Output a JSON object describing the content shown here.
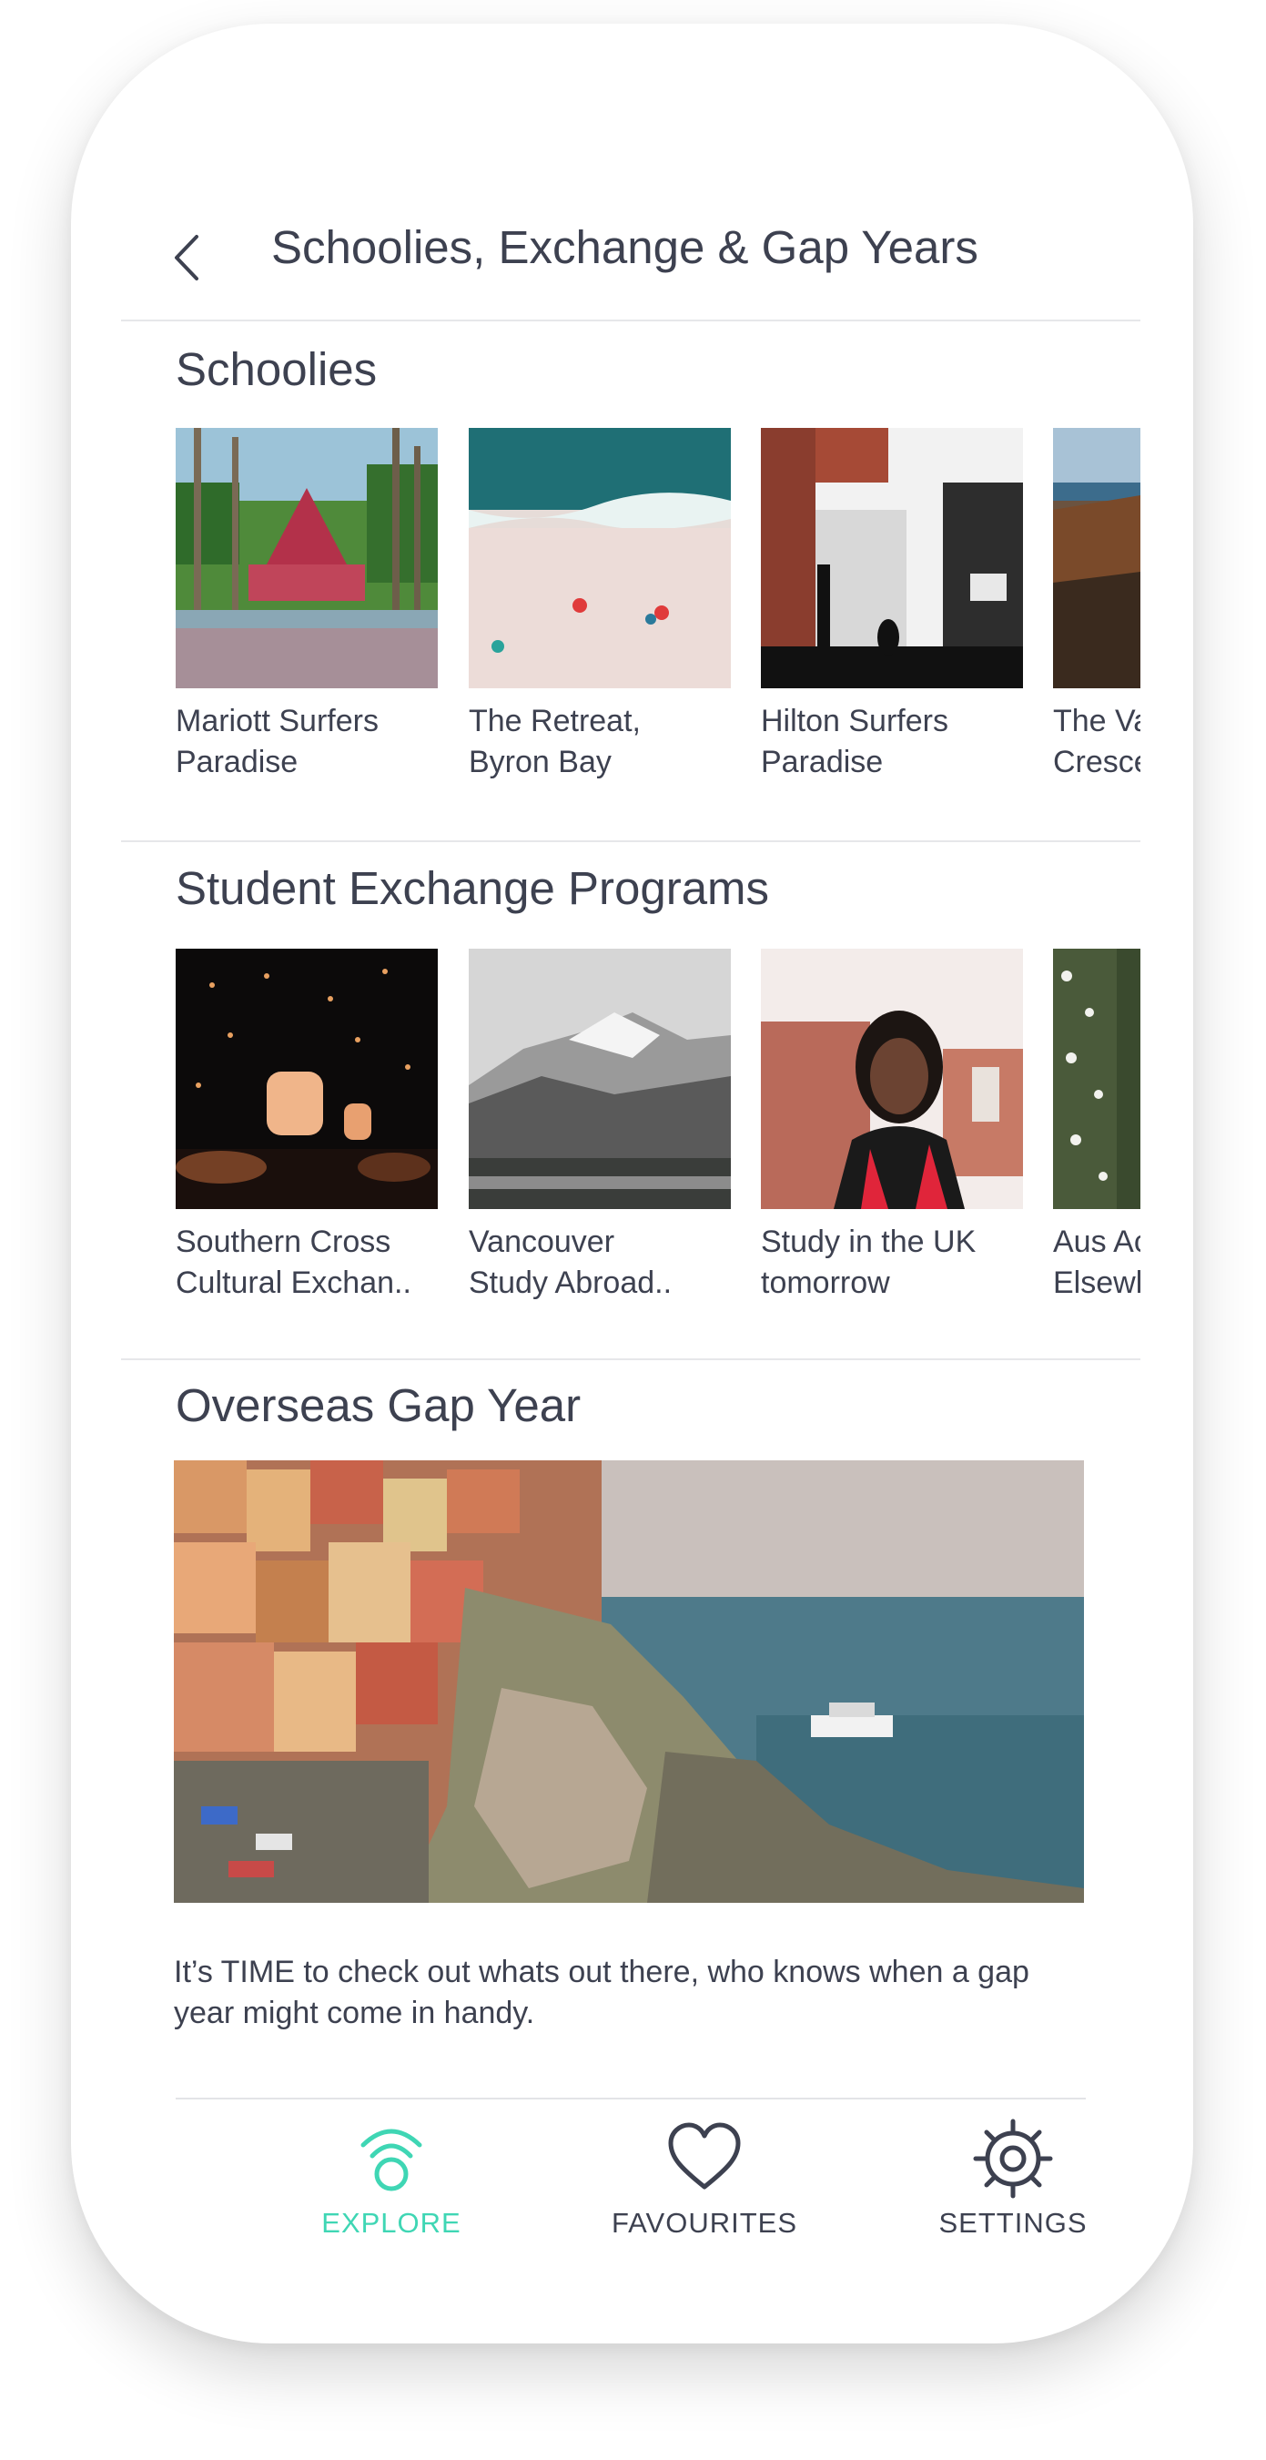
{
  "header": {
    "title": "Schoolies, Exchange & Gap Years"
  },
  "sections": {
    "schoolies": {
      "title": "Schoolies",
      "cards": [
        {
          "line1": "Mariott Surfers",
          "line2": "Paradise"
        },
        {
          "line1": "The Retreat,",
          "line2": "Byron Bay"
        },
        {
          "line1": "Hilton Surfers",
          "line2": "Paradise"
        },
        {
          "line1": "The Va",
          "line2": "Cresce"
        }
      ]
    },
    "exchange": {
      "title": "Student Exchange Programs",
      "cards": [
        {
          "line1": "Southern Cross",
          "line2": "Cultural Exchan.."
        },
        {
          "line1": "Vancouver",
          "line2": "Study Abroad.."
        },
        {
          "line1": "Study in the UK",
          "line2": "tomorrow"
        },
        {
          "line1": "Aus Ac",
          "line2": "Elsewl"
        }
      ]
    },
    "gap_year": {
      "title": "Overseas Gap Year",
      "description": "It’s TIME to check out whats out there, who knows when a gap year might come in handy."
    }
  },
  "tabs": [
    {
      "label": "EXPLORE",
      "icon": "explore-icon",
      "active": true
    },
    {
      "label": "FAVOURITES",
      "icon": "heart-icon",
      "active": false
    },
    {
      "label": "SETTINGS",
      "icon": "gear-icon",
      "active": false
    }
  ],
  "colors": {
    "accent": "#3fd6b4",
    "text": "#3d4150",
    "divider": "#e6e7ea"
  }
}
